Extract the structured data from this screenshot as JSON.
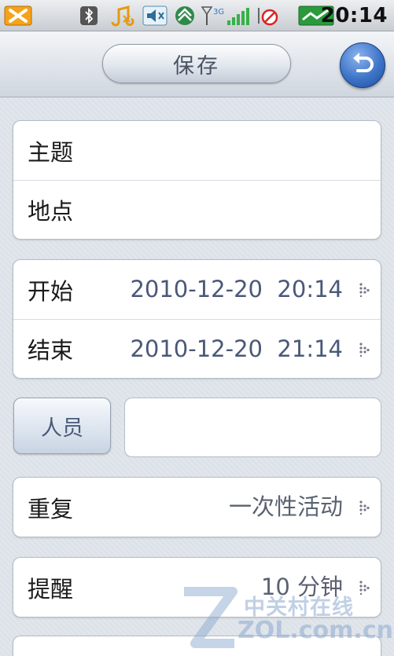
{
  "status_bar": {
    "time": "20:14",
    "icons": [
      "notification-x-icon",
      "bluetooth-icon",
      "music-icon",
      "volume-icon",
      "sync-icon",
      "signal-3g-icon",
      "alarm-off-icon",
      "battery-icon"
    ]
  },
  "toolbar": {
    "save_label": "保存",
    "back_icon": "back-arrow-icon"
  },
  "form": {
    "subject_label": "主题",
    "location_label": "地点",
    "start_label": "开始",
    "start_value": "2010-12-20  20:14",
    "end_label": "结束",
    "end_value": "2010-12-20  21:14",
    "people_button": "人员",
    "people_value": "",
    "repeat_label": "重复",
    "repeat_value": "一次性活动",
    "reminder_label": "提醒",
    "reminder_value": "10 分钟"
  },
  "watermark": {
    "text_cn": "中关村在线",
    "text_en": "ZOL.com.cn"
  },
  "colors": {
    "accent_blue": "#3e74c8",
    "value_text": "#4a5878",
    "background": "#dde2e9"
  }
}
